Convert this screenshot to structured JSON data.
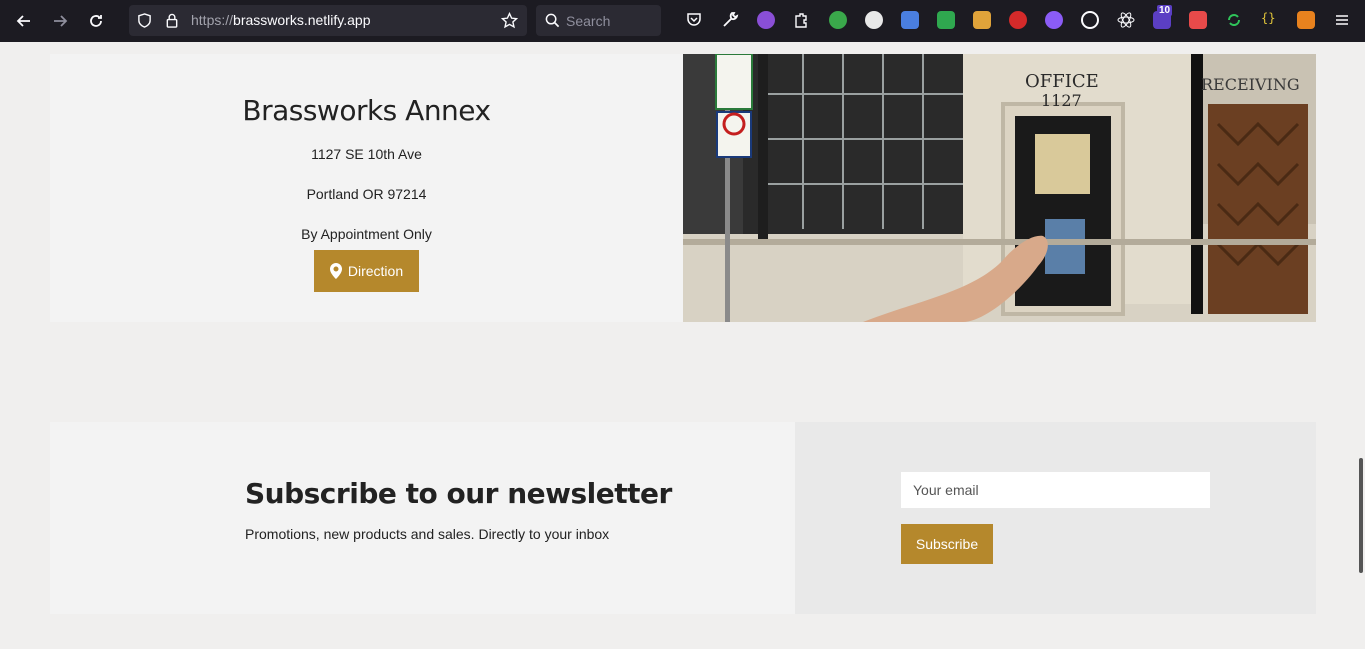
{
  "browser": {
    "url_scheme": "https://",
    "url_host": "brassworks.netlify.app",
    "search_placeholder": "Search",
    "badge_count": "10"
  },
  "annex": {
    "title": "Brassworks Annex",
    "address_line1": "1127 SE 10th Ave",
    "address_line2": "Portland OR 97214",
    "note": "By Appointment Only",
    "direction_label": "Direction"
  },
  "photo": {
    "sign_office": "OFFICE",
    "sign_number": "1127",
    "sign_receiving": "RECEIVING"
  },
  "newsletter": {
    "title": "Subscribe to our newsletter",
    "subtitle": "Promotions, new products and sales. Directly to your inbox",
    "email_placeholder": "Your email",
    "subscribe_label": "Subscribe"
  },
  "colors": {
    "accent": "#b5882c",
    "toolbar": "#1c1b22",
    "page_bg": "#f0efee"
  }
}
